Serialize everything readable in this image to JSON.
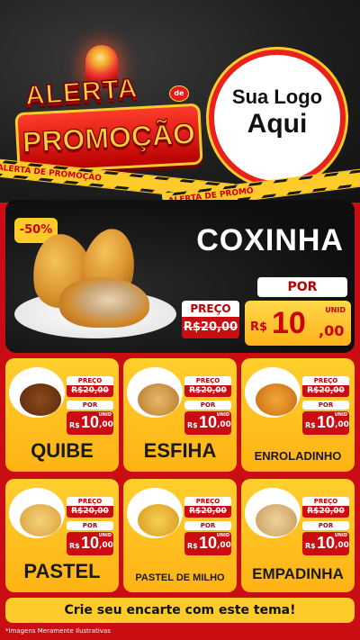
{
  "header": {
    "alerta": "ALERTA",
    "de": "de",
    "promocao": "PROMOÇÃO",
    "logo_line1": "Sua Logo",
    "logo_line2": "Aqui"
  },
  "tapes": {
    "left_text": "ALERTA DE PROMOÇÃO",
    "right_text": "ALERTA DE PROMO"
  },
  "hero": {
    "discount": "-50%",
    "title": "COXINHA",
    "preco_label": "PREÇO",
    "old_price": "R$20,00",
    "por_label": "POR",
    "currency": "R$",
    "price_int": "10",
    "price_cents": ",00",
    "unit": "UNID"
  },
  "products": [
    {
      "name": "QUIBE",
      "preco": "PREÇO",
      "old": "R$20,00",
      "por": "POR",
      "cur": "R$",
      "int": "10",
      "cents": ",00",
      "unid": "UNID"
    },
    {
      "name": "ESFIHA",
      "preco": "PREÇO",
      "old": "R$20,00",
      "por": "POR",
      "cur": "R$",
      "int": "10",
      "cents": ",00",
      "unid": "UNID"
    },
    {
      "name": "ENROLADINHO",
      "preco": "PREÇO",
      "old": "R$20,00",
      "por": "POR",
      "cur": "R$",
      "int": "10",
      "cents": ",00",
      "unid": "UNID"
    },
    {
      "name": "PASTEL",
      "preco": "PREÇO",
      "old": "R$20,00",
      "por": "POR",
      "cur": "R$",
      "int": "10",
      "cents": ",00",
      "unid": "UNID"
    },
    {
      "name": "PASTEL DE MILHO",
      "preco": "PREÇO",
      "old": "R$20,00",
      "por": "POR",
      "cur": "R$",
      "int": "10",
      "cents": ",00",
      "unid": "UNID"
    },
    {
      "name": "EMPADINHA",
      "preco": "PREÇO",
      "old": "R$20,00",
      "por": "POR",
      "cur": "R$",
      "int": "10",
      "cents": ",00",
      "unid": "UNID"
    }
  ],
  "footer": {
    "cta": "Crie seu encarte com este tema!",
    "disclaimer": "*Imagens Meramente Ilustrativas"
  },
  "colors": {
    "brand_red": "#c90d12",
    "accent_yellow": "#ffcb2a"
  }
}
